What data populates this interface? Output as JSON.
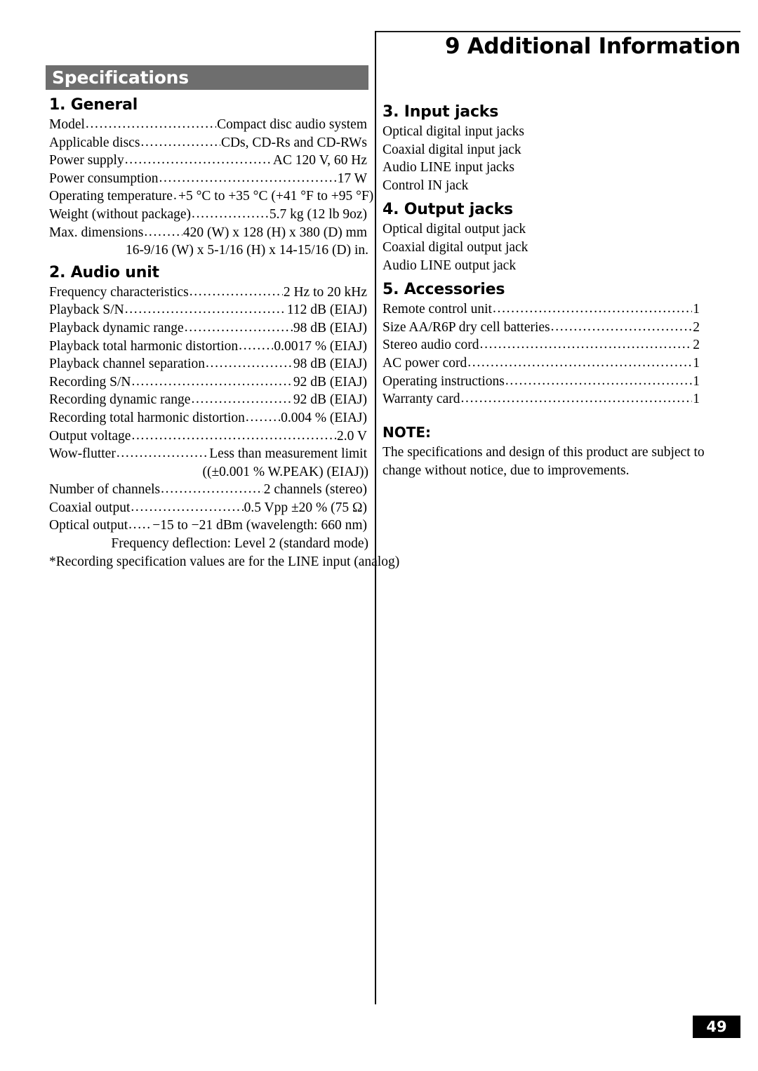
{
  "header": {
    "chapter_title": "9 Additional Information"
  },
  "page_number": "49",
  "left_column": {
    "banner_title": "Specifications",
    "section1": {
      "heading": "1. General",
      "rows": [
        {
          "label": "Model",
          "value": "Compact disc audio system"
        },
        {
          "label": "Applicable discs",
          "value": "CDs, CD-Rs and CD-RWs"
        },
        {
          "label": "Power supply",
          "value": "AC 120 V, 60 Hz"
        },
        {
          "label": "Power consumption",
          "value": "17 W"
        },
        {
          "label": "Operating temperature",
          "value": "+5 °C to +35 °C (+41 °F to +95 °F)"
        },
        {
          "label": "Weight (without package)",
          "value": "5.7 kg (12 lb 9oz)"
        },
        {
          "label": "Max. dimensions",
          "value": "420 (W) x 128 (H) x 380 (D) mm"
        }
      ],
      "continuation": "16-9/16 (W) x 5-1/16 (H) x 14-15/16 (D) in."
    },
    "section2": {
      "heading": "2. Audio unit",
      "rows": [
        {
          "label": "Frequency characteristics",
          "value": "2 Hz to 20 kHz"
        },
        {
          "label": "Playback S/N",
          "value": "112 dB (EIAJ)"
        },
        {
          "label": "Playback dynamic range",
          "value": "98 dB (EIAJ)"
        },
        {
          "label": "Playback total harmonic distortion",
          "value": "0.0017 % (EIAJ)"
        },
        {
          "label": "Playback channel separation",
          "value": "98 dB (EIAJ)"
        },
        {
          "label": "Recording S/N",
          "value": "92 dB (EIAJ)"
        },
        {
          "label": "Recording dynamic range",
          "value": "92 dB (EIAJ)"
        },
        {
          "label": "Recording total harmonic distortion",
          "value": "0.004 % (EIAJ)"
        },
        {
          "label": "Output voltage",
          "value": "2.0 V"
        },
        {
          "label": "Wow-flutter",
          "value": "Less than measurement limit"
        }
      ],
      "wow_flutter_continuation": "((±0.001 % W.PEAK) (EIAJ))",
      "rows_after": [
        {
          "label": "Number of channels",
          "value": "2 channels (stereo)"
        },
        {
          "label": "Coaxial output",
          "value": "0.5 Vpp ±20 % (75 Ω)"
        },
        {
          "label": "Optical output",
          "value": "−15 to −21 dBm (wavelength: 660 nm)"
        }
      ],
      "optical_continuation": "Frequency deflection: Level 2 (standard mode)",
      "footnote": "*Recording specification values are for the LINE input (analog)"
    }
  },
  "right_column": {
    "section3": {
      "heading": "3. Input jacks",
      "items": [
        "Optical digital input jacks",
        "Coaxial digital input jack",
        "Audio LINE input jacks",
        "Control IN jack"
      ]
    },
    "section4": {
      "heading": "4. Output jacks",
      "items": [
        "Optical digital output jack",
        "Coaxial digital output jack",
        "Audio LINE output jack"
      ]
    },
    "section5": {
      "heading": "5. Accessories",
      "rows": [
        {
          "label": "Remote control unit",
          "value": "1"
        },
        {
          "label": "Size AA/R6P dry cell batteries",
          "value": "2"
        },
        {
          "label": "Stereo audio cord",
          "value": "2"
        },
        {
          "label": "AC power cord",
          "value": "1"
        },
        {
          "label": "Operating instructions",
          "value": "1"
        },
        {
          "label": "Warranty card",
          "value": "1"
        }
      ]
    },
    "note": {
      "heading": "NOTE:",
      "body": "The specifications and design of this product are subject to change without notice, due to improvements."
    }
  }
}
